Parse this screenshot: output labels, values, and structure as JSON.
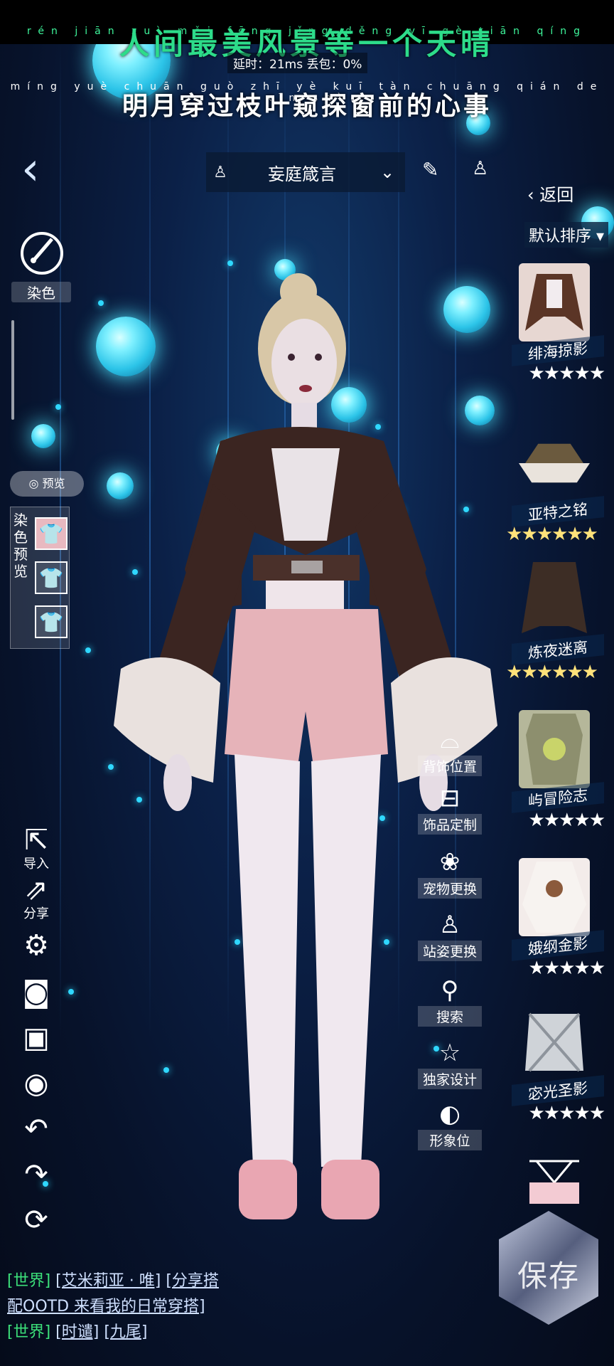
{
  "lyrics": {
    "line1_pinyin": "rén jiān zuì měi fēng jǐng děng yī gè tiān qíng",
    "line1": "人间最美风景等一个天晴",
    "line2_pinyin": "míng yuè chuān guò zhī yè kuī tàn chuāng qián de xīn shì",
    "line2": "明月穿过枝叶窥探窗前的心事"
  },
  "net_status": "延时：21ms 丢包：0%",
  "header": {
    "outfit_name": "妄庭箴言"
  },
  "left_panel": {
    "dye_label": "染色",
    "preview_toggle": "预览",
    "dye_preview_label": "染色预览",
    "import_label": "导入",
    "share_label": "分享"
  },
  "right_panel": {
    "return_label": "返回",
    "sort_label": "默认排序"
  },
  "items": [
    {
      "name": "绯海掠影",
      "stars": 5,
      "star_style": "white"
    },
    {
      "name": "亚特之铭",
      "stars": 6,
      "star_style": "gold"
    },
    {
      "name": "炼夜迷离",
      "stars": 6,
      "star_style": "gold"
    },
    {
      "name": "屿冒险志",
      "stars": 5,
      "star_style": "white"
    },
    {
      "name": "娥纲金影",
      "stars": 5,
      "star_style": "white"
    },
    {
      "name": "宓光圣影",
      "stars": 5,
      "star_style": "white"
    }
  ],
  "side_menu": [
    {
      "icon": "hanger-icon",
      "label": "背饰位置"
    },
    {
      "icon": "bag-icon",
      "label": "饰品定制"
    },
    {
      "icon": "paw-icon",
      "label": "宠物更换"
    },
    {
      "icon": "person-icon",
      "label": "站姿更换"
    },
    {
      "icon": "search-icon",
      "label": "搜索"
    },
    {
      "icon": "star-icon",
      "label": "独家设计"
    },
    {
      "icon": "portrait-icon",
      "label": "形象位"
    }
  ],
  "save_label": "保存",
  "chat": {
    "line1_channel": "[世界]",
    "line1_user": "[艾米莉亚 · 唯]",
    "line1_link": "[分享搭",
    "line2_text": "配OOTD 来看我的日常穿搭]",
    "line3_channel": "[世界]",
    "line3_user": "[时谴]",
    "line3_link": "[九尾]"
  },
  "colors": {
    "background": "#0b2047",
    "orb": "#2cc4e8",
    "lyric_green": "#2ddc8a",
    "chat_channel": "#3ce07a",
    "star_gold": "#ffe27a"
  }
}
